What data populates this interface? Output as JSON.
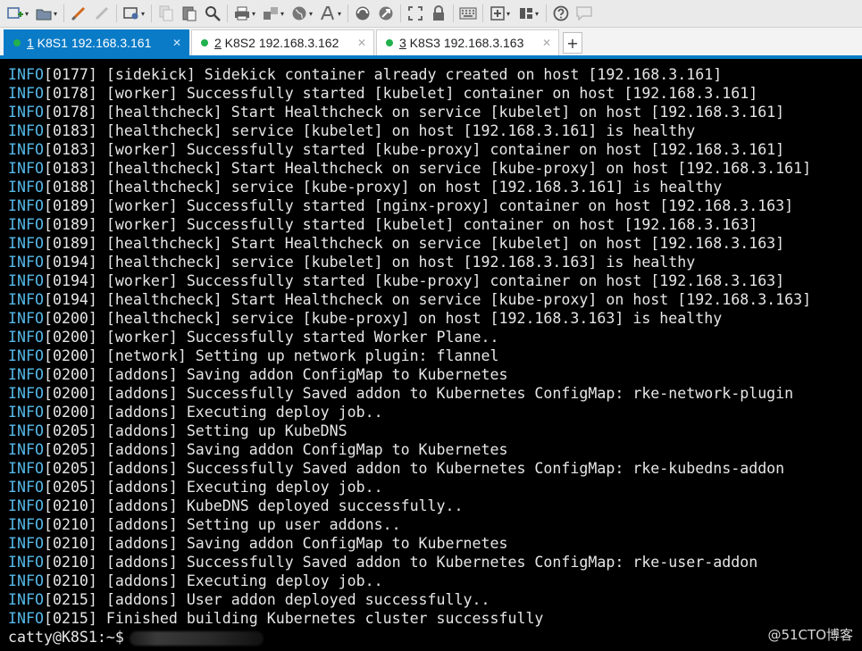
{
  "toolbar": {
    "icons": [
      "new-session-icon",
      "open-folder-icon",
      "reconnect-icon",
      "disconnect-icon",
      "session-options-icon",
      "copy-icon",
      "paste-icon",
      "find-icon",
      "print-icon",
      "transfer-icon",
      "globe-icon",
      "font-icon",
      "script-icon",
      "sftp-icon",
      "fullscreen-icon",
      "lock-icon",
      "keyboard-icon",
      "add-icon",
      "layout-icon",
      "help-icon",
      "chat-icon"
    ]
  },
  "tabs": [
    {
      "num": "1",
      "label": " K8S1 192.168.3.161",
      "active": true
    },
    {
      "num": "2",
      "label": " K8S2 192.168.3.162",
      "active": false
    },
    {
      "num": "3",
      "label": " K8S3 192.168.3.163",
      "active": false
    }
  ],
  "tab_add_label": "+",
  "terminal": {
    "lines": [
      {
        "level": "INFO",
        "text": "[0177] [sidekick] Sidekick container already created on host [192.168.3.161]"
      },
      {
        "level": "INFO",
        "text": "[0178] [worker] Successfully started [kubelet] container on host [192.168.3.161]"
      },
      {
        "level": "INFO",
        "text": "[0178] [healthcheck] Start Healthcheck on service [kubelet] on host [192.168.3.161]"
      },
      {
        "level": "INFO",
        "text": "[0183] [healthcheck] service [kubelet] on host [192.168.3.161] is healthy"
      },
      {
        "level": "INFO",
        "text": "[0183] [worker] Successfully started [kube-proxy] container on host [192.168.3.161]"
      },
      {
        "level": "INFO",
        "text": "[0183] [healthcheck] Start Healthcheck on service [kube-proxy] on host [192.168.3.161]"
      },
      {
        "level": "INFO",
        "text": "[0188] [healthcheck] service [kube-proxy] on host [192.168.3.161] is healthy"
      },
      {
        "level": "INFO",
        "text": "[0189] [worker] Successfully started [nginx-proxy] container on host [192.168.3.163]"
      },
      {
        "level": "INFO",
        "text": "[0189] [worker] Successfully started [kubelet] container on host [192.168.3.163]"
      },
      {
        "level": "INFO",
        "text": "[0189] [healthcheck] Start Healthcheck on service [kubelet] on host [192.168.3.163]"
      },
      {
        "level": "INFO",
        "text": "[0194] [healthcheck] service [kubelet] on host [192.168.3.163] is healthy"
      },
      {
        "level": "INFO",
        "text": "[0194] [worker] Successfully started [kube-proxy] container on host [192.168.3.163]"
      },
      {
        "level": "INFO",
        "text": "[0194] [healthcheck] Start Healthcheck on service [kube-proxy] on host [192.168.3.163]"
      },
      {
        "level": "INFO",
        "text": "[0200] [healthcheck] service [kube-proxy] on host [192.168.3.163] is healthy"
      },
      {
        "level": "INFO",
        "text": "[0200] [worker] Successfully started Worker Plane.."
      },
      {
        "level": "INFO",
        "text": "[0200] [network] Setting up network plugin: flannel"
      },
      {
        "level": "INFO",
        "text": "[0200] [addons] Saving addon ConfigMap to Kubernetes"
      },
      {
        "level": "INFO",
        "text": "[0200] [addons] Successfully Saved addon to Kubernetes ConfigMap: rke-network-plugin"
      },
      {
        "level": "INFO",
        "text": "[0200] [addons] Executing deploy job.."
      },
      {
        "level": "INFO",
        "text": "[0205] [addons] Setting up KubeDNS"
      },
      {
        "level": "INFO",
        "text": "[0205] [addons] Saving addon ConfigMap to Kubernetes"
      },
      {
        "level": "INFO",
        "text": "[0205] [addons] Successfully Saved addon to Kubernetes ConfigMap: rke-kubedns-addon"
      },
      {
        "level": "INFO",
        "text": "[0205] [addons] Executing deploy job.."
      },
      {
        "level": "INFO",
        "text": "[0210] [addons] KubeDNS deployed successfully.."
      },
      {
        "level": "INFO",
        "text": "[0210] [addons] Setting up user addons.."
      },
      {
        "level": "INFO",
        "text": "[0210] [addons] Saving addon ConfigMap to Kubernetes"
      },
      {
        "level": "INFO",
        "text": "[0210] [addons] Successfully Saved addon to Kubernetes ConfigMap: rke-user-addon"
      },
      {
        "level": "INFO",
        "text": "[0210] [addons] Executing deploy job.."
      },
      {
        "level": "INFO",
        "text": "[0215] [addons] User addon deployed successfully.."
      },
      {
        "level": "INFO",
        "text": "[0215] Finished building Kubernetes cluster successfully"
      }
    ],
    "prompt": "catty@K8S1:~$"
  },
  "watermark": "@51CTO博客",
  "colors": {
    "accent": "#0a7bc7",
    "status_dot": "#22b14c",
    "info": "#55b8e8"
  }
}
